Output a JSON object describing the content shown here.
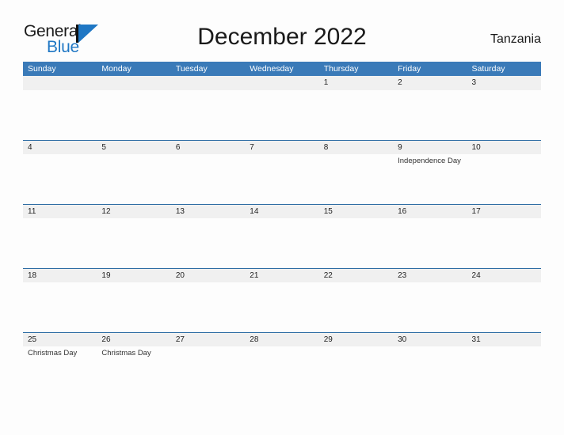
{
  "brand": {
    "name_part1": "General",
    "name_part2": "Blue",
    "mark": "triangle-logo-icon",
    "accent_color": "#1f77c4"
  },
  "header": {
    "title": "December 2022",
    "region": "Tanzania"
  },
  "colors": {
    "header_blue": "#3a7ab8",
    "row_divider_blue": "#2e6da4",
    "date_strip_gray": "#f0f0f0",
    "page_background": "#fdfdfd"
  },
  "weekdays": [
    "Sunday",
    "Monday",
    "Tuesday",
    "Wednesday",
    "Thursday",
    "Friday",
    "Saturday"
  ],
  "weeks": [
    {
      "days": [
        {
          "num": "",
          "event": ""
        },
        {
          "num": "",
          "event": ""
        },
        {
          "num": "",
          "event": ""
        },
        {
          "num": "",
          "event": ""
        },
        {
          "num": "1",
          "event": ""
        },
        {
          "num": "2",
          "event": ""
        },
        {
          "num": "3",
          "event": ""
        }
      ]
    },
    {
      "days": [
        {
          "num": "4",
          "event": ""
        },
        {
          "num": "5",
          "event": ""
        },
        {
          "num": "6",
          "event": ""
        },
        {
          "num": "7",
          "event": ""
        },
        {
          "num": "8",
          "event": ""
        },
        {
          "num": "9",
          "event": "Independence Day"
        },
        {
          "num": "10",
          "event": ""
        }
      ]
    },
    {
      "days": [
        {
          "num": "11",
          "event": ""
        },
        {
          "num": "12",
          "event": ""
        },
        {
          "num": "13",
          "event": ""
        },
        {
          "num": "14",
          "event": ""
        },
        {
          "num": "15",
          "event": ""
        },
        {
          "num": "16",
          "event": ""
        },
        {
          "num": "17",
          "event": ""
        }
      ]
    },
    {
      "days": [
        {
          "num": "18",
          "event": ""
        },
        {
          "num": "19",
          "event": ""
        },
        {
          "num": "20",
          "event": ""
        },
        {
          "num": "21",
          "event": ""
        },
        {
          "num": "22",
          "event": ""
        },
        {
          "num": "23",
          "event": ""
        },
        {
          "num": "24",
          "event": ""
        }
      ]
    },
    {
      "days": [
        {
          "num": "25",
          "event": "Christmas Day"
        },
        {
          "num": "26",
          "event": "Christmas Day"
        },
        {
          "num": "27",
          "event": ""
        },
        {
          "num": "28",
          "event": ""
        },
        {
          "num": "29",
          "event": ""
        },
        {
          "num": "30",
          "event": ""
        },
        {
          "num": "31",
          "event": ""
        }
      ]
    }
  ]
}
